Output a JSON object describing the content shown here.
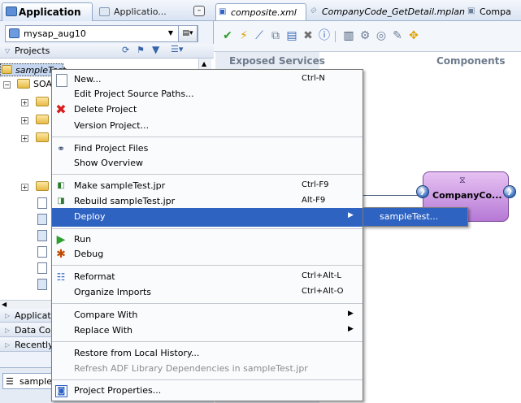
{
  "left_panel": {
    "tabs": {
      "active": "Application",
      "inactive": "Applicatio..."
    },
    "app_combo": {
      "value": "mysap_aug10"
    },
    "projects_label": "Projects",
    "tree": {
      "selected": "sampleTest",
      "child": "SOA"
    },
    "accordion": [
      "Applicat",
      "Data Co",
      "Recently"
    ],
    "bottom_tab": "sampleT"
  },
  "editor": {
    "tabs": [
      "composite.xml",
      "CompanyCode_GetDetail.mplan",
      "Compa"
    ],
    "lanes": {
      "exposed_services": "Exposed Services",
      "components": "Components"
    },
    "component_label": "CompanyCo..."
  },
  "context_menu": {
    "items": [
      {
        "label": "New...",
        "accel": "Ctrl-N",
        "icon": "new-icon"
      },
      {
        "label": "Edit Project Source Paths..."
      },
      {
        "label": "Delete Project",
        "icon": "delete-icon"
      },
      {
        "label": "Version Project..."
      },
      {
        "label": "Find Project Files",
        "icon": "binoculars-icon"
      },
      {
        "label": "Show Overview"
      },
      {
        "label": "Make sampleTest.jpr",
        "accel": "Ctrl-F9",
        "icon": "make-icon"
      },
      {
        "label": "Rebuild sampleTest.jpr",
        "accel": "Alt-F9",
        "icon": "rebuild-icon"
      },
      {
        "label": "Deploy",
        "submenu": true
      },
      {
        "label": "Run",
        "icon": "run-icon"
      },
      {
        "label": "Debug",
        "icon": "debug-icon"
      },
      {
        "label": "Reformat",
        "accel": "Ctrl+Alt-L",
        "icon": "reformat-icon"
      },
      {
        "label": "Organize Imports",
        "accel": "Ctrl+Alt-O"
      },
      {
        "label": "Compare With",
        "submenu": true
      },
      {
        "label": "Replace With",
        "submenu": true
      },
      {
        "label": "Restore from Local History..."
      },
      {
        "label": "Refresh ADF Library Dependencies in sampleTest.jpr",
        "disabled": true
      },
      {
        "label": "Project Properties...",
        "icon": "properties-icon"
      }
    ],
    "deploy_submenu": [
      "sampleTest..."
    ]
  },
  "colors": {
    "menu_highlight": "#2f63c2",
    "component_fill": "#c58fe0",
    "panel_bg": "#eef3fb"
  }
}
